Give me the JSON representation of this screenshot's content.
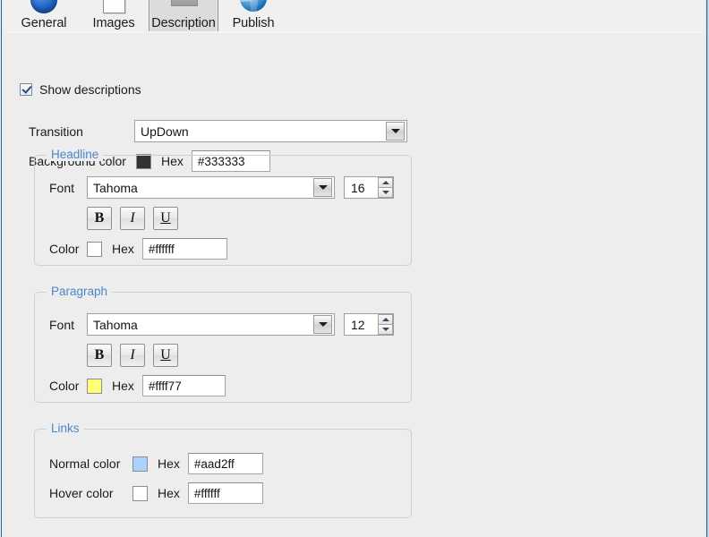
{
  "window": {
    "tabs": [
      {
        "label": "General",
        "icon": "blue-circle-icon",
        "selected": false
      },
      {
        "label": "Images",
        "icon": "page-icon",
        "selected": false
      },
      {
        "label": "Description",
        "icon": "gray-rect-icon",
        "selected": true
      },
      {
        "label": "Publish",
        "icon": "globe-icon",
        "selected": false
      }
    ]
  },
  "form": {
    "show_descriptions": {
      "label": "Show descriptions",
      "checked": true
    },
    "transition": {
      "label": "Transition",
      "value": "UpDown"
    },
    "background_color": {
      "label": "Background color",
      "hex_label": "Hex",
      "value": "#333333",
      "swatch": "#333333"
    },
    "headline": {
      "legend": "Headline",
      "font_label": "Font",
      "font_value": "Tahoma",
      "size_value": "16",
      "bold_label": "B",
      "italic_label": "I",
      "underline_label": "U",
      "color_label": "Color",
      "hex_label": "Hex",
      "color_value": "#ffffff",
      "swatch": "#ffffff"
    },
    "paragraph": {
      "legend": "Paragraph",
      "font_label": "Font",
      "font_value": "Tahoma",
      "size_value": "12",
      "bold_label": "B",
      "italic_label": "I",
      "underline_label": "U",
      "color_label": "Color",
      "hex_label": "Hex",
      "color_value": "#ffff77",
      "swatch": "#ffff77"
    },
    "links": {
      "legend": "Links",
      "normal": {
        "label": "Normal color",
        "hex_label": "Hex",
        "value": "#aad2ff",
        "swatch": "#aad2ff"
      },
      "hover": {
        "label": "Hover color",
        "hex_label": "Hex",
        "value": "#ffffff",
        "swatch": "#ffffff"
      }
    }
  }
}
